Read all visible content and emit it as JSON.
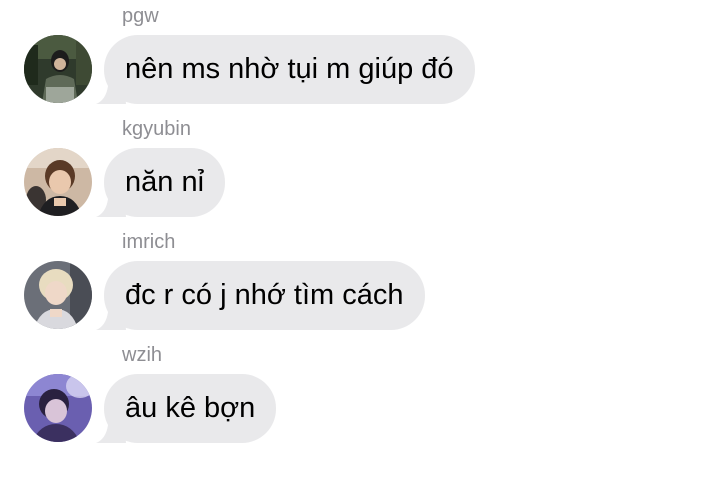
{
  "messages": [
    {
      "sender": "pgw",
      "text": "nên ms nhờ tụi m giúp đó",
      "avatar": "avatar-photo-dark-outdoor"
    },
    {
      "sender": "kgyubin",
      "text": "năn nỉ",
      "avatar": "avatar-photo-brown-hair"
    },
    {
      "sender": "imrich",
      "text": "đc r có j nhớ tìm cách",
      "avatar": "avatar-photo-blonde-hair"
    },
    {
      "sender": "wzih",
      "text": "âu kê bợn",
      "avatar": "avatar-photo-purple-light"
    }
  ],
  "colors": {
    "bubble": "#e9e9eb",
    "sender_label": "#8e8e93",
    "message_text": "#000000",
    "background": "#ffffff"
  }
}
